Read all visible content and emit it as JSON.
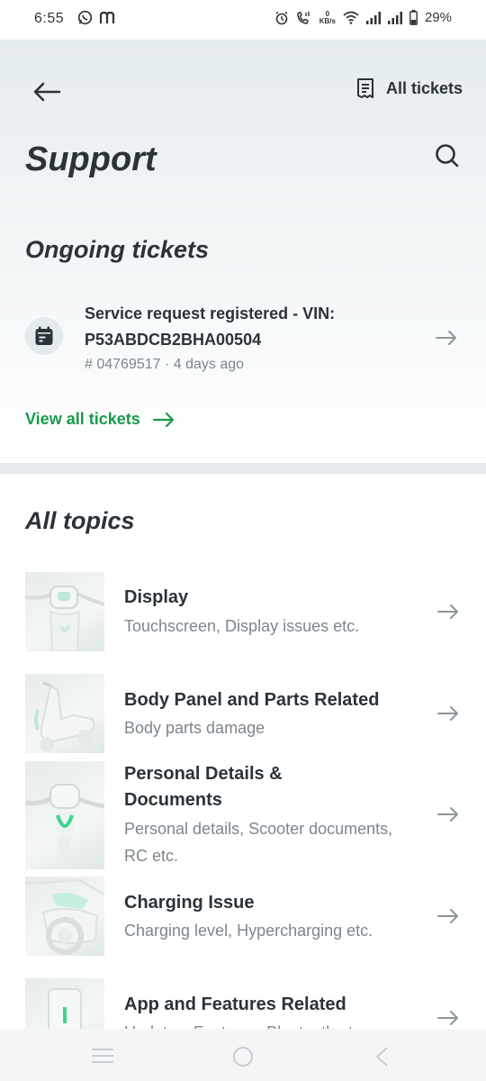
{
  "status_bar": {
    "time": "6:55",
    "left_icons": [
      "whatsapp-icon",
      "m-app-icon"
    ],
    "right_icons": [
      "alarm-icon",
      "volte-call-icon",
      "network-speed-icon",
      "wifi-icon",
      "signal-icon",
      "signal-icon",
      "battery-icon"
    ],
    "speed_value": "0",
    "speed_unit": "KB/s",
    "battery": "29%"
  },
  "header": {
    "all_tickets_label": "All tickets",
    "title": "Support"
  },
  "ongoing": {
    "heading": "Ongoing tickets",
    "ticket": {
      "title": "Service request registered - VIN: P53ABDCB2BHA00504",
      "meta": "# 04769517 · 4 days ago"
    },
    "view_all_label": "View all tickets"
  },
  "topics": {
    "heading": "All topics",
    "items": [
      {
        "title": "Display",
        "subtitle": "Touchscreen, Display issues etc."
      },
      {
        "title": "Body Panel and Parts Related",
        "subtitle": "Body parts damage"
      },
      {
        "title": "Personal Details & Documents",
        "subtitle": "Personal details, Scooter documents, RC etc."
      },
      {
        "title": "Charging Issue",
        "subtitle": "Charging level, Hypercharging etc."
      },
      {
        "title": "App and Features Related",
        "subtitle": "Updates, Features, Bluetooth etc."
      }
    ]
  },
  "colors": {
    "accent_green": "#1a9b4b",
    "text_dark": "#2b3339",
    "text_muted": "#7d868c"
  }
}
